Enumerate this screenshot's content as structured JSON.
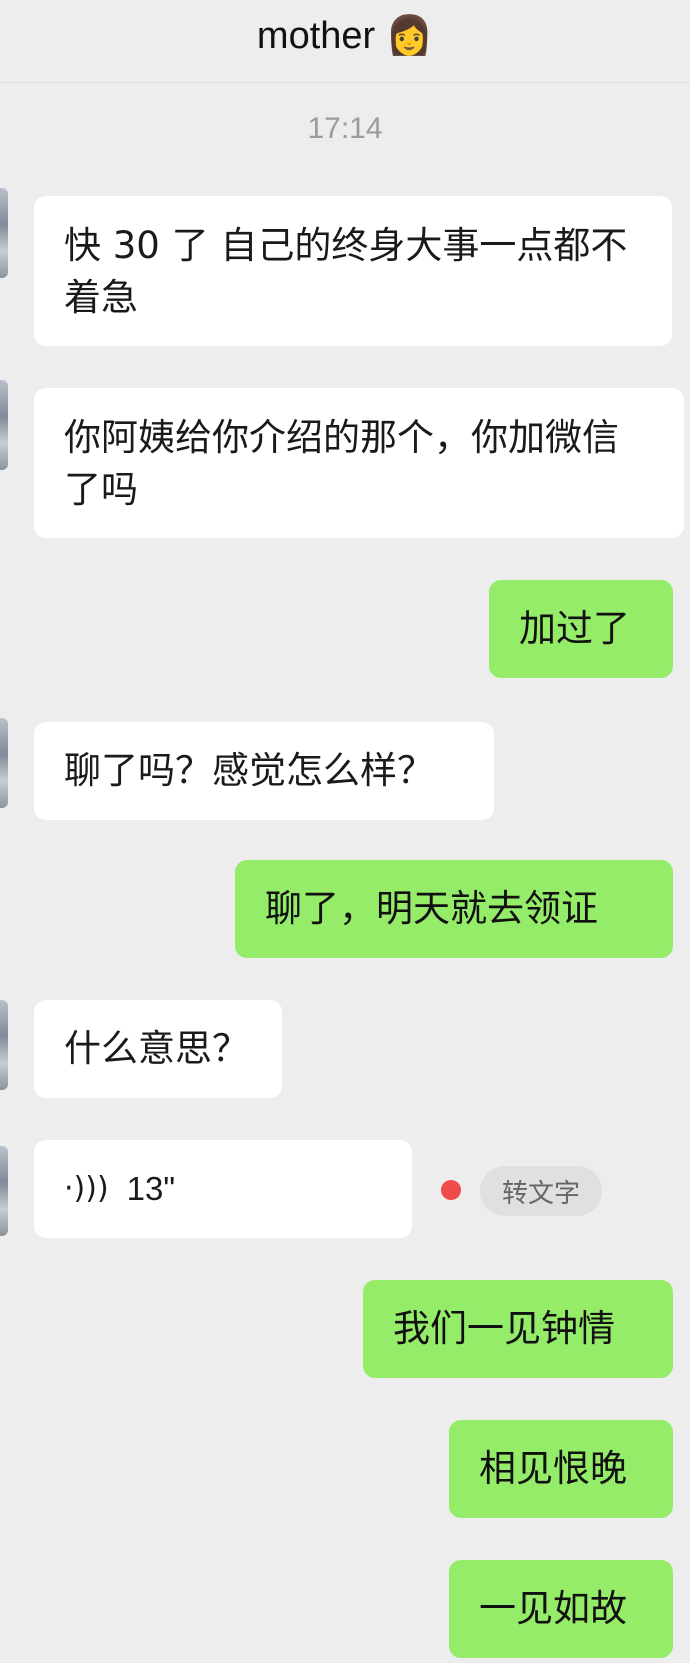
{
  "header": {
    "title": "mother 👩"
  },
  "timestamp": "17:14",
  "messages": [
    {
      "side": "in",
      "text": "快 30 了 自己的终身大事一点都不着急"
    },
    {
      "side": "in",
      "text": "你阿姨给你介绍的那个，你加微信了吗"
    },
    {
      "side": "out",
      "text": "加过了"
    },
    {
      "side": "in",
      "text": "聊了吗？感觉怎么样？"
    },
    {
      "side": "out",
      "text": "聊了，明天就去领证"
    },
    {
      "side": "in",
      "text": "什么意思？"
    },
    {
      "side": "in",
      "type": "voice",
      "duration": "13\"",
      "convert_label": "转文字"
    },
    {
      "side": "out",
      "text": "我们一见钟情"
    },
    {
      "side": "out",
      "text": "相见恨晚"
    },
    {
      "side": "out",
      "text": "一见如故"
    }
  ],
  "colors": {
    "background": "#ededed",
    "incoming_bubble": "#ffffff",
    "outgoing_bubble": "#95ec69",
    "unread_dot": "#f04b4b"
  },
  "icons": {
    "voice": "voice-wave-icon",
    "avatar": "contact-avatar"
  }
}
